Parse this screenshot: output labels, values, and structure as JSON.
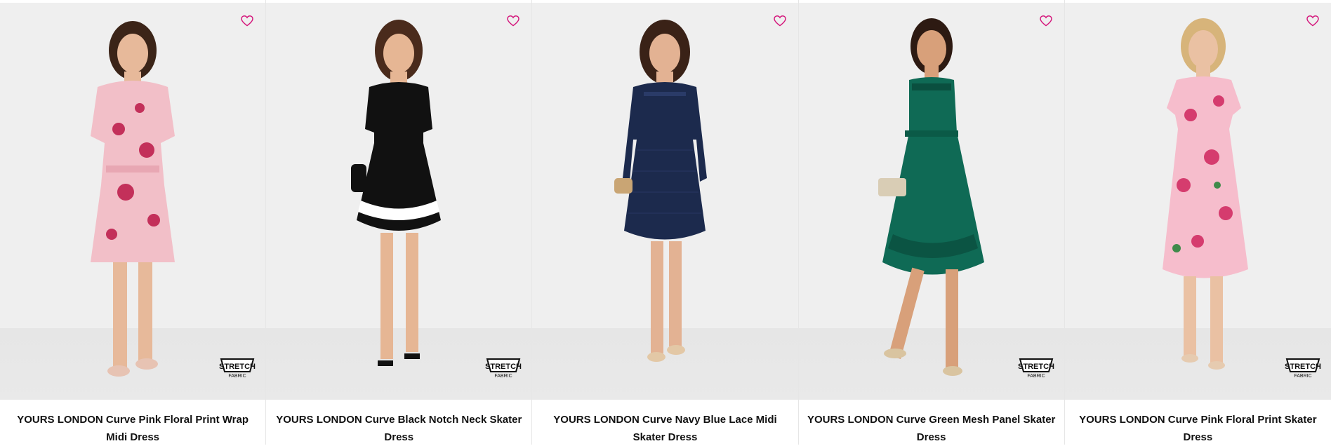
{
  "products": [
    {
      "title": "YOURS LONDON Curve Pink Floral Print Wrap Midi Dress",
      "badge_text": "STRETCH FABRIC",
      "dress_color": "#f2bfc8",
      "accent_color": "#c3305a",
      "hair_color": "#3b2418",
      "skin_color": "#e7b99a",
      "shoe_color": "#e7c3b3"
    },
    {
      "title": "YOURS LONDON Curve Black Notch Neck Skater Dress",
      "badge_text": "STRETCH FABRIC",
      "dress_color": "#111111",
      "accent_color": "#ffffff",
      "hair_color": "#4a2b1c",
      "skin_color": "#e6b694",
      "shoe_color": "#111111"
    },
    {
      "title": "YOURS LONDON Curve Navy Blue Lace Midi Skater Dress",
      "badge_text": "",
      "dress_color": "#1c2a4d",
      "accent_color": "#2a3b68",
      "hair_color": "#3a2217",
      "skin_color": "#e3b293",
      "shoe_color": "#e3c8a6"
    },
    {
      "title": "YOURS LONDON Curve Green Mesh Panel Skater Dress",
      "badge_text": "STRETCH FABRIC",
      "dress_color": "#0f6a55",
      "accent_color": "#0a4f3f",
      "hair_color": "#2d1a12",
      "skin_color": "#d8a07a",
      "shoe_color": "#d9c4a0"
    },
    {
      "title": "YOURS LONDON Curve Pink Floral Print Skater Dress",
      "badge_text": "STRETCH FABRIC",
      "dress_color": "#f6bdcc",
      "accent_color": "#d53c6e",
      "hair_color": "#d7b47a",
      "skin_color": "#eac1a3",
      "shoe_color": "#e6cbb0"
    }
  ],
  "icons": {
    "wishlist": "heart-outline-icon",
    "badge": "stretch-fabric-icon"
  },
  "colors": {
    "heart": "#d4147a",
    "background": "#efefef"
  }
}
